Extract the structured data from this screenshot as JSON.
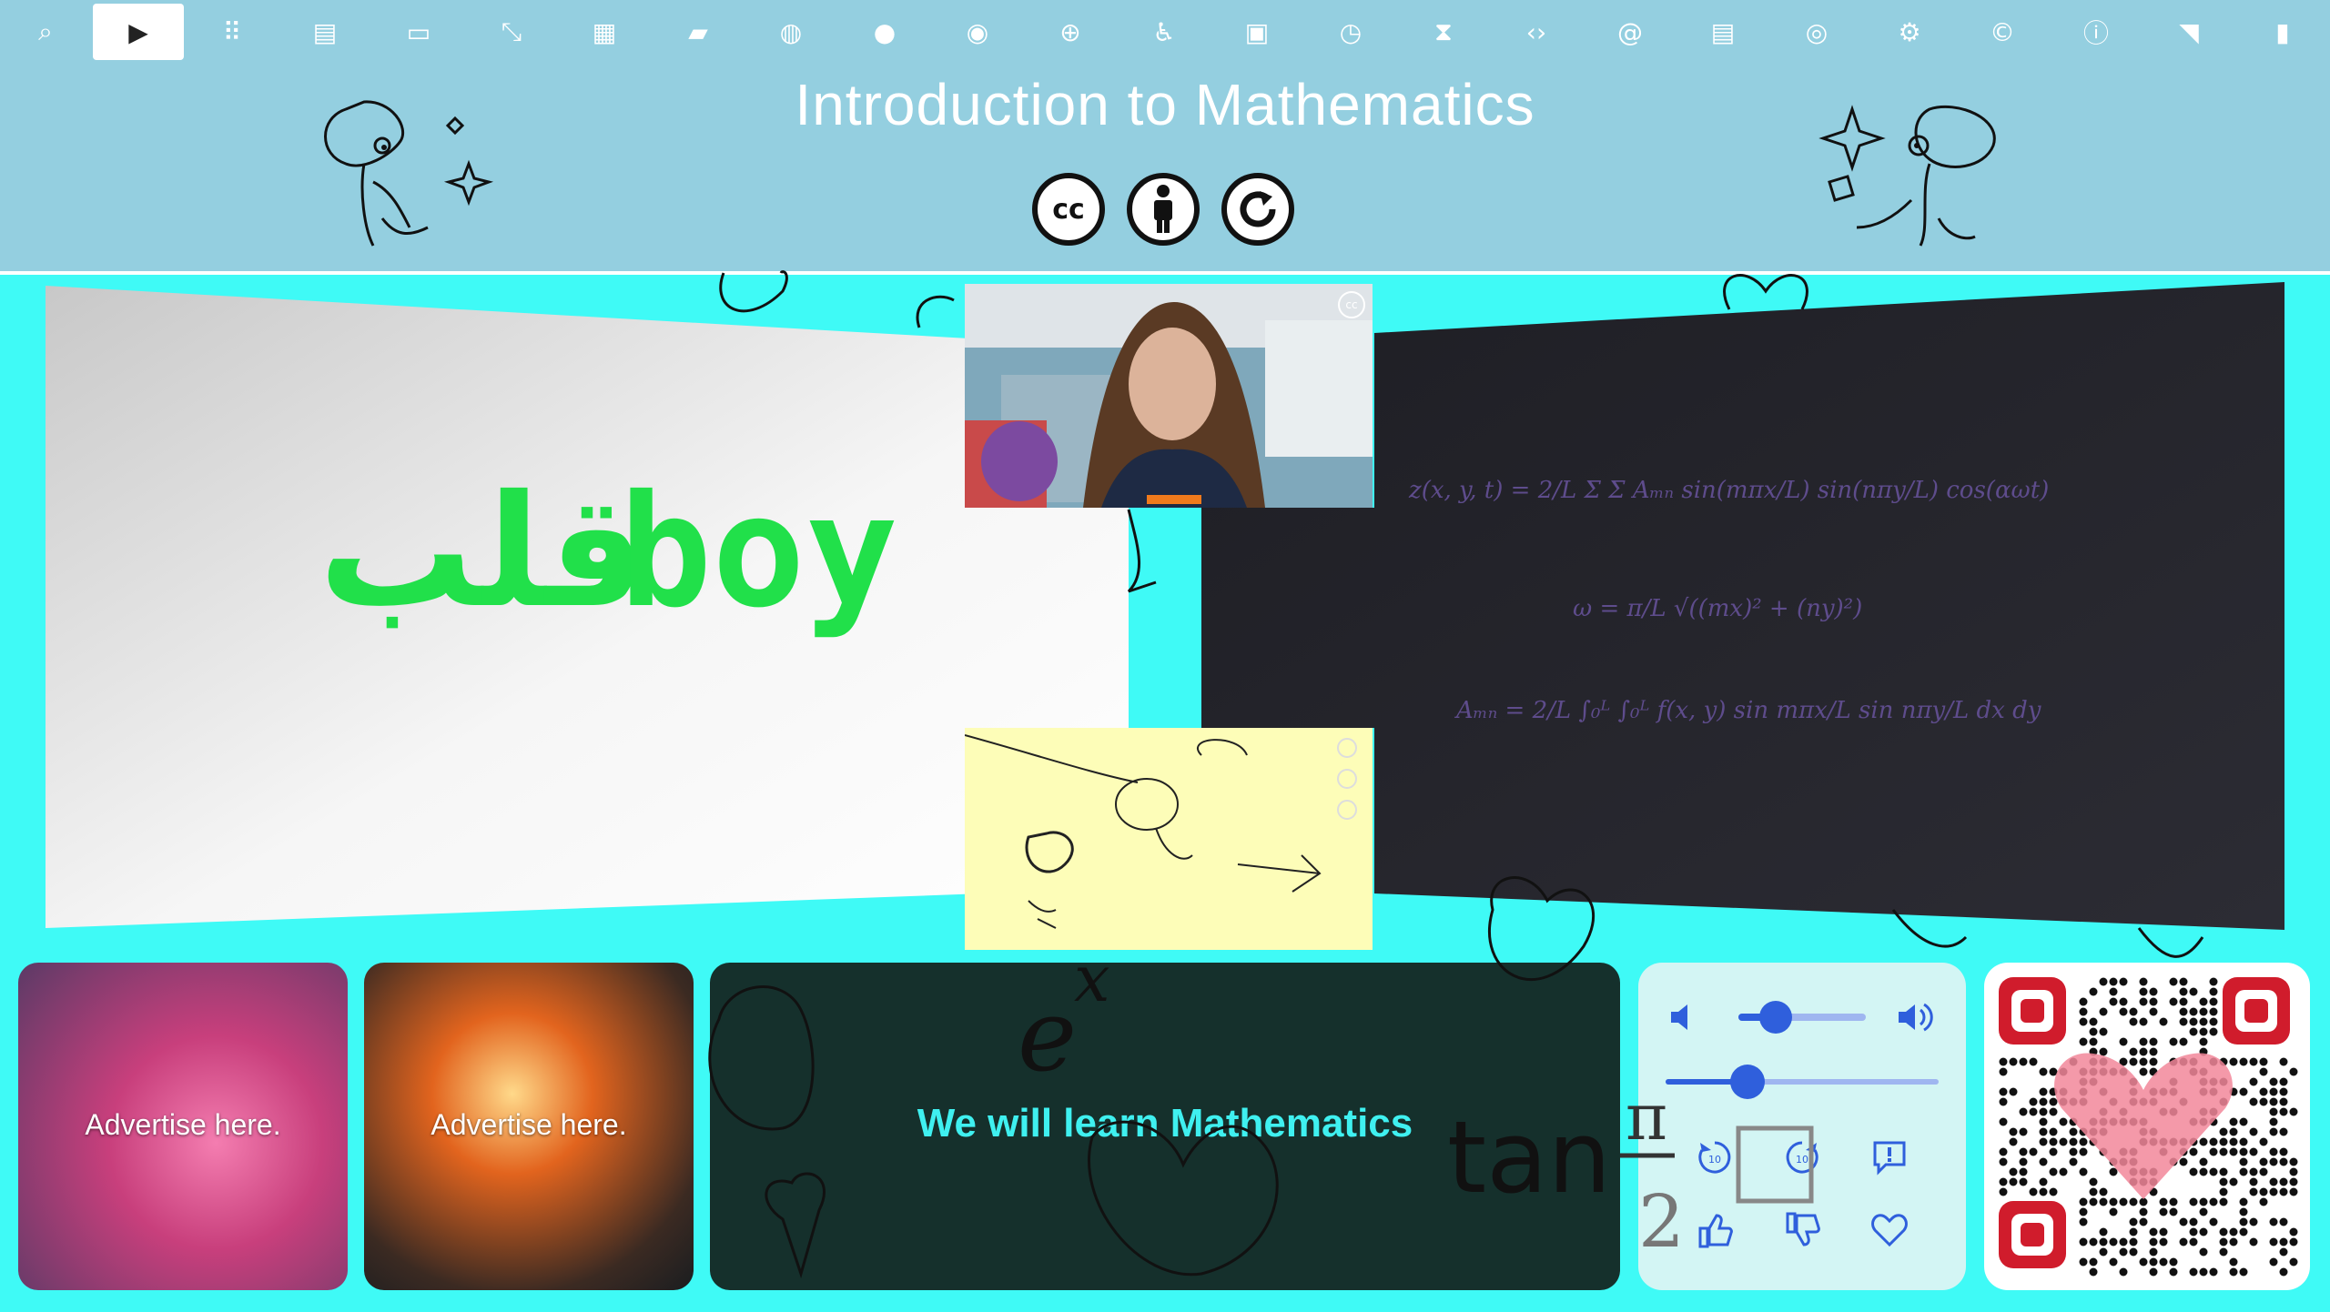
{
  "header": {
    "title": "Introduction to Mathematics",
    "license_badges": [
      "cc",
      "attribution",
      "share-alike"
    ]
  },
  "toolbar": {
    "items": [
      {
        "icon": "search-icon",
        "glyph": "⌕"
      },
      {
        "icon": "play-icon",
        "glyph": "▶",
        "active": true
      },
      {
        "icon": "grid-icon",
        "glyph": "⠿"
      },
      {
        "icon": "document-icon",
        "glyph": "▤"
      },
      {
        "icon": "gamepad-icon",
        "glyph": "▭"
      },
      {
        "icon": "expand-icon",
        "glyph": "⤡"
      },
      {
        "icon": "calendar-icon",
        "glyph": "▦"
      },
      {
        "icon": "book-icon",
        "glyph": "▰"
      },
      {
        "icon": "globe-icon",
        "glyph": "◍"
      },
      {
        "icon": "mosaic-icon",
        "glyph": "●"
      },
      {
        "icon": "lightbulb-icon",
        "glyph": "◉"
      },
      {
        "icon": "language-icon",
        "glyph": "⊕"
      },
      {
        "icon": "accessibility-icon",
        "glyph": "♿"
      },
      {
        "icon": "lock-icon",
        "glyph": "▣"
      },
      {
        "icon": "timer-icon",
        "glyph": "◷"
      },
      {
        "icon": "hourglass-icon",
        "glyph": "⧗"
      },
      {
        "icon": "code-icon",
        "glyph": "‹›"
      },
      {
        "icon": "at-icon",
        "glyph": "@"
      },
      {
        "icon": "radio-icon",
        "glyph": "▤"
      },
      {
        "icon": "fingerprint-icon",
        "glyph": "◎"
      },
      {
        "icon": "gear-icon",
        "glyph": "⚙"
      },
      {
        "icon": "copyright-icon",
        "glyph": "©"
      },
      {
        "icon": "info-icon",
        "glyph": "ⓘ"
      },
      {
        "icon": "wifi-icon",
        "glyph": "◥"
      },
      {
        "icon": "battery-icon",
        "glyph": "▮"
      }
    ]
  },
  "slides": {
    "left_logo_text": "ﻗﻠﺐ",
    "left_logo_latin": "boy",
    "logo_color": "#21e04a",
    "equations": [
      "z(x, y, t) = 2/L Σ Σ Aₘₙ sin(mπx/L) sin(nπy/L) cos(αωt)",
      "ω = π/L √((mx)² + (ny)²)",
      "Aₘₙ = 2/L ∫₀ᴸ ∫₀ᴸ f(x, y) sin mπx/L sin nπy/L dx dy"
    ],
    "webcam_badge": "cc"
  },
  "bottom": {
    "ads": [
      {
        "label": "Advertise here."
      },
      {
        "label": "Advertise here."
      }
    ],
    "caption": "We will learn Mathematics",
    "controls": {
      "volume_level": 0.29,
      "progress_level": 0.3
    }
  },
  "overlay_text": {
    "ex": "e",
    "ex_sup": "x",
    "tan": "tan",
    "frac_num": "π",
    "frac_den": "2"
  },
  "colors": {
    "background": "#3ffaf6",
    "header": "#94cfe0",
    "caption_bg": "#15302c",
    "caption_text": "#3ff0f0",
    "controls_bg": "#d3f5f4",
    "control_accent": "#2f5fdc",
    "qr_accent": "#d01c2c"
  }
}
